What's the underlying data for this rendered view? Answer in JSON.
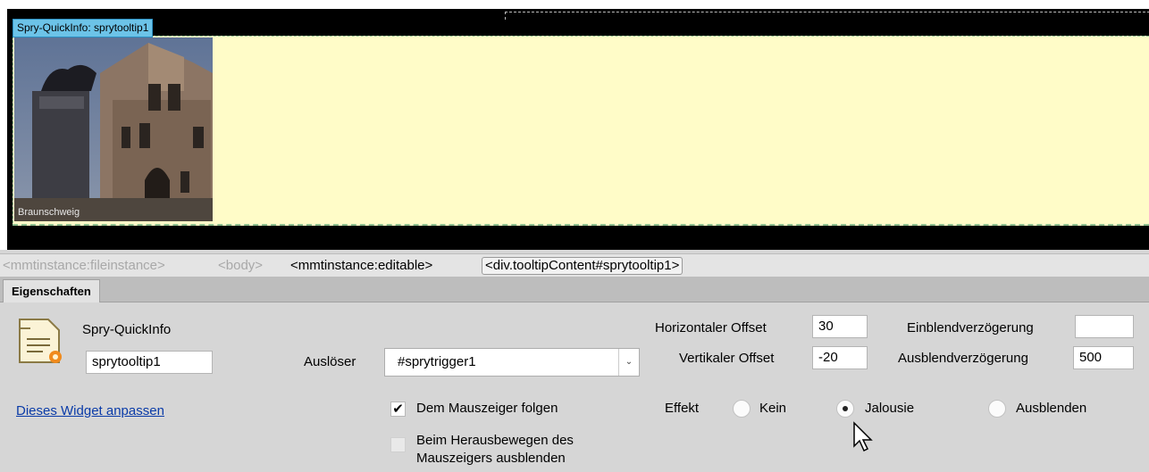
{
  "design": {
    "widget_tab": "Spry-QuickInfo: sprytooltip1",
    "photo_caption": "Braunschweig"
  },
  "tag_selector": {
    "tags": [
      "<mmtinstance:fileinstance>",
      "<body>",
      "<mmtinstance:editable>",
      "<div.tooltipContent#sprytooltip1>"
    ]
  },
  "panel": {
    "tab": "Eigenschaften",
    "widget_type": "Spry-QuickInfo",
    "widget_id": "sprytooltip1",
    "customize_link": "Dieses Widget anpassen",
    "trigger_label": "Auslöser",
    "trigger_value": "#sprytrigger1",
    "follow_mouse_label": "Dem Mauszeiger folgen",
    "follow_mouse_checked": true,
    "hide_on_out_label_line1": "Beim Herausbewegen des",
    "hide_on_out_label_line2": "Mauszeigers ausblenden",
    "hide_on_out_checked": false,
    "h_offset_label": "Horizontaler Offset",
    "h_offset_value": "30",
    "v_offset_label": "Vertikaler Offset",
    "v_offset_value": "-20",
    "show_delay_label": "Einblendverzögerung",
    "show_delay_value": "",
    "hide_delay_label": "Ausblendverzögerung",
    "hide_delay_value": "500",
    "effect_label": "Effekt",
    "effects": [
      "Kein",
      "Jalousie",
      "Ausblenden"
    ],
    "selected_effect": "Jalousie"
  },
  "colors": {
    "tooltip_bg": "#fffcc8",
    "widget_tab_bg": "#6cc3e8",
    "link": "#0a3ba8"
  }
}
